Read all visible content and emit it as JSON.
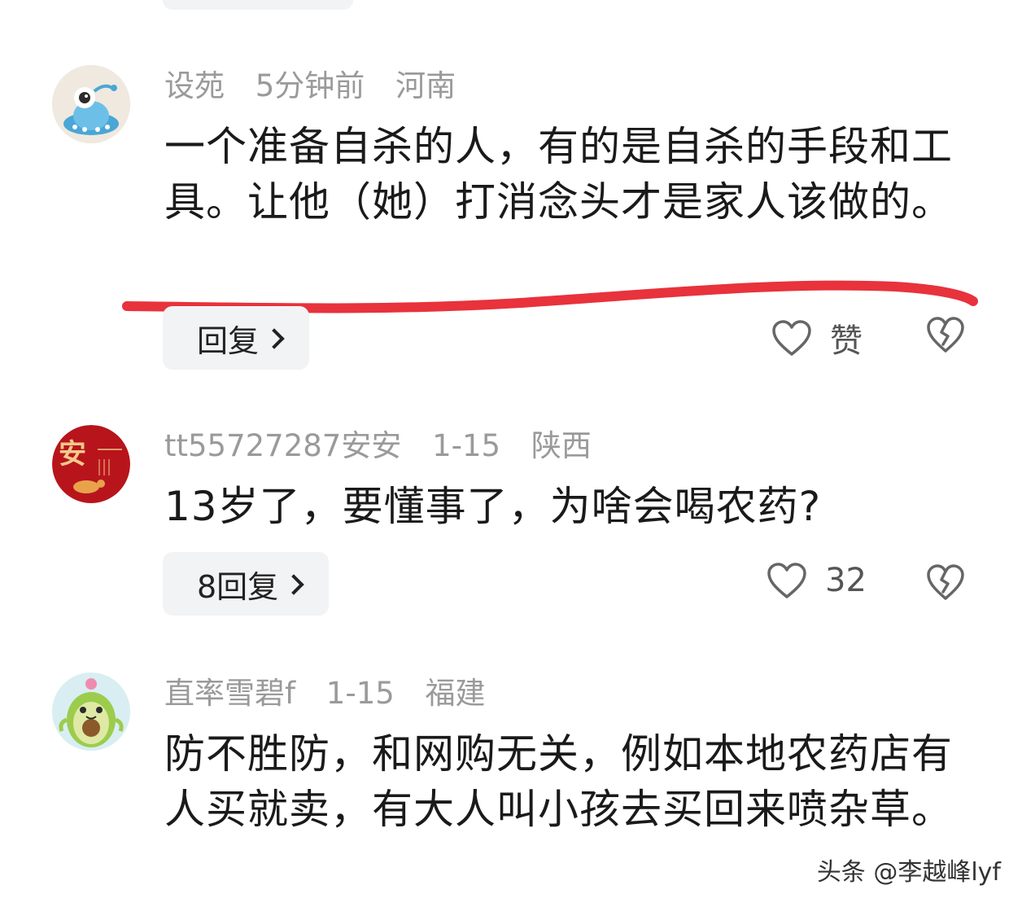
{
  "comments": [
    {
      "username": "设苑",
      "time": "5分钟前",
      "location": "河南",
      "text": "一个准备自杀的人，有的是自杀的手段和工具。让他（她）打消念头才是家人该做的。",
      "reply_label": "回复",
      "like_label": "赞",
      "avatar_icon": "alien-ufo-icon"
    },
    {
      "username": "tt55727287安安",
      "time": "1-15",
      "location": "陕西",
      "text": "13岁了，要懂事了，为啥会喝农药?",
      "reply_label": "8回复",
      "like_label": "32",
      "avatar_icon": "red-an-calligraphy-icon",
      "avatar_text": "安"
    },
    {
      "username": "直率雪碧f",
      "time": "1-15",
      "location": "福建",
      "text": "防不胜防，和网购无关，例如本地农药店有人买就卖，有大人叫小孩去买回来喷杂草。",
      "avatar_icon": "avocado-icon"
    }
  ],
  "watermark": "头条 @李越峰lyf",
  "colors": {
    "underline": "#e8323c",
    "meta": "#9a9a9a",
    "reply_bg": "#f2f3f5"
  }
}
